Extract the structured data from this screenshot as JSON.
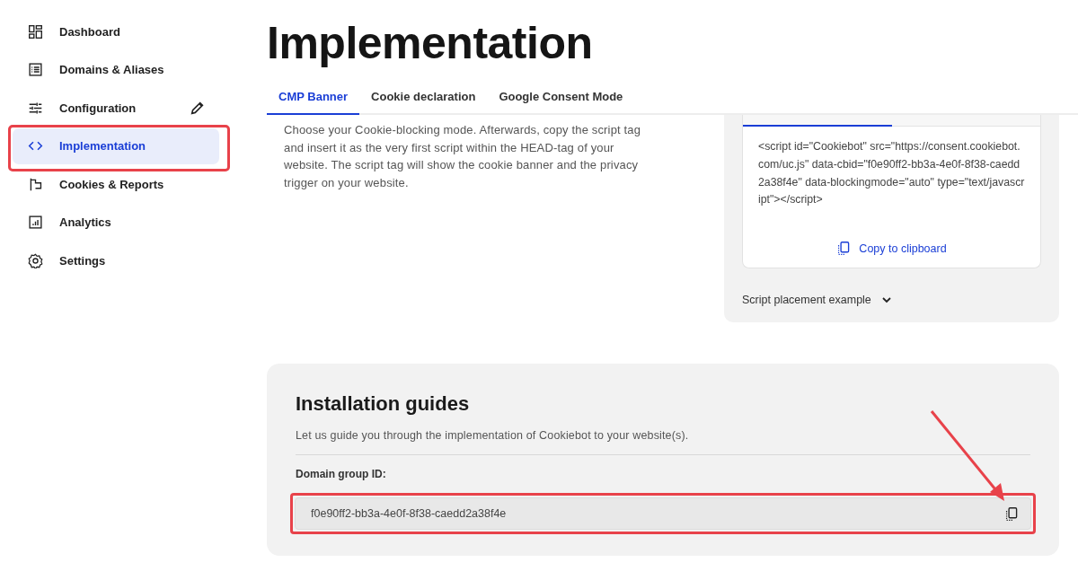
{
  "sidebar": {
    "items": [
      {
        "label": "Dashboard",
        "selected": false,
        "editable": false
      },
      {
        "label": "Domains & Aliases",
        "selected": false,
        "editable": false
      },
      {
        "label": "Configuration",
        "selected": false,
        "editable": true
      },
      {
        "label": "Implementation",
        "selected": true,
        "editable": false
      },
      {
        "label": "Cookies & Reports",
        "selected": false,
        "editable": false
      },
      {
        "label": "Analytics",
        "selected": false,
        "editable": false
      },
      {
        "label": "Settings",
        "selected": false,
        "editable": false
      }
    ]
  },
  "page_title": "Implementation",
  "tabs": [
    {
      "label": "CMP Banner",
      "selected": true
    },
    {
      "label": "Cookie declaration",
      "selected": false
    },
    {
      "label": "Google Consent Mode",
      "selected": false
    }
  ],
  "intro": "Choose your Cookie-blocking mode. Afterwards, copy the script tag and insert it as the very first script within the HEAD-tag of your website. The script tag will show the cookie banner and the privacy trigger on your website.",
  "script_card": {
    "code": "<script id=\"Cookiebot\" src=\"https://consent.cookiebot.com/uc.js\" data-cbid=\"f0e90ff2-bb3a-4e0f-8f38-caedd2a38f4e\" data-blockingmode=\"auto\" type=\"text/javascript\"></script>",
    "copy_button": "Copy to clipboard",
    "placement_toggle": "Script placement example"
  },
  "installation": {
    "title": "Installation guides",
    "description": "Let us guide you through the implementation of Cookiebot to your website(s).",
    "field_label": "Domain group ID:",
    "field_value": "f0e90ff2-bb3a-4e0f-8f38-caedd2a38f4e"
  }
}
